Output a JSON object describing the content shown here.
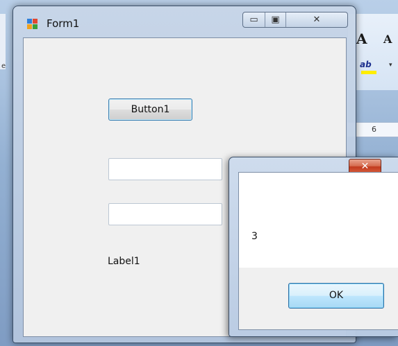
{
  "background_app": {
    "ribbon_grow_font_glyph": "A",
    "ribbon_shrink_font_glyph": "A",
    "highlight_glyph": "ab",
    "dropdown_glyph": "▾",
    "ruler_number": "6",
    "left_letter": "e"
  },
  "form1": {
    "title": "Form1",
    "minimize_glyph": "▭",
    "maximize_glyph": "▣",
    "close_glyph": "✕",
    "button1_label": "Button1",
    "textbox1_value": "",
    "textbox2_value": "",
    "label1_text": "Label1"
  },
  "msgbox": {
    "close_glyph": "✕",
    "message": "3",
    "ok_label": "OK"
  },
  "colors": {
    "window_frame": "#c8d6e8",
    "client_bg": "#f0f0f0",
    "close_red": "#c23a1e",
    "highlight_yellow": "#ffee00"
  }
}
